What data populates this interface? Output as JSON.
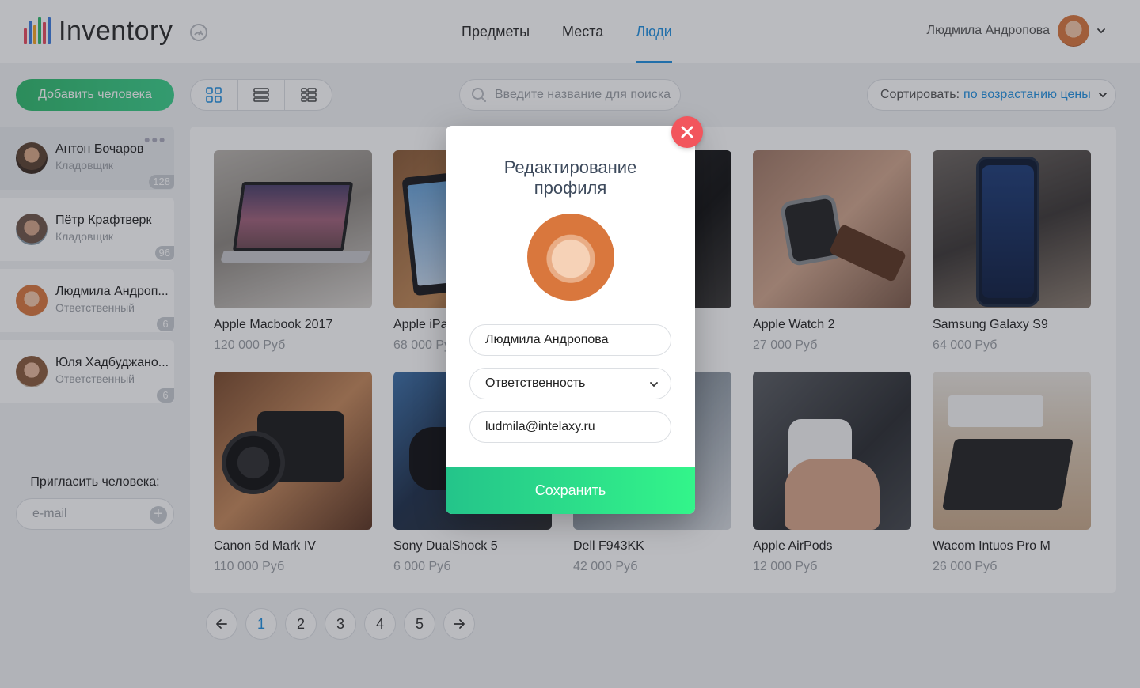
{
  "app": {
    "title": "Inventory"
  },
  "nav": {
    "items": [
      "Предметы",
      "Места",
      "Люди"
    ],
    "active_index": 2
  },
  "user": {
    "name": "Людмила Андропова"
  },
  "toolbar": {
    "add_person_label": "Добавить человека",
    "search_placeholder": "Введите название для поиска",
    "sort_label": "Сортировать:",
    "sort_value": "по возрастанию цены"
  },
  "people": [
    {
      "name": "Антон Бочаров",
      "role": "Кладовщик",
      "count": "128"
    },
    {
      "name": "Пётр Крафтверк",
      "role": "Кладовщик",
      "count": "96"
    },
    {
      "name": "Людмила Андроп...",
      "role": "Ответственный",
      "count": "6"
    },
    {
      "name": "Юля Хадбуджано...",
      "role": "Ответственный",
      "count": "6"
    }
  ],
  "invite": {
    "title": "Пригласить человека:",
    "placeholder": "e-mail"
  },
  "products": [
    {
      "title": "Apple Macbook 2017",
      "price": "120 000 Руб"
    },
    {
      "title": "Apple iPad",
      "price": "68 000 Руб"
    },
    {
      "title": "",
      "price": ""
    },
    {
      "title": "Apple Watch 2",
      "price": "27 000 Руб"
    },
    {
      "title": "Samsung Galaxy S9",
      "price": "64 000 Руб"
    },
    {
      "title": "Canon 5d Mark IV",
      "price": "110 000 Руб"
    },
    {
      "title": "Sony DualShock 5",
      "price": "6 000 Руб"
    },
    {
      "title": "Dell F943KK",
      "price": "42 000 Руб"
    },
    {
      "title": "Apple AirPods",
      "price": "12 000 Руб"
    },
    {
      "title": "Wacom Intuos Pro M",
      "price": "26 000 Руб"
    }
  ],
  "pagination": {
    "pages": [
      "1",
      "2",
      "3",
      "4",
      "5"
    ],
    "active_page": "1"
  },
  "modal": {
    "title_line1": "Редактирование",
    "title_line2": "профиля",
    "name_value": "Людмила Андропова",
    "role_value": "Ответственность",
    "email_value": "ludmila@intelaxy.ru",
    "save_label": "Сохранить"
  },
  "colors": {
    "accent": "#1e8fe1",
    "primary_green": "#2fba6c",
    "close_red": "#f2565d"
  }
}
